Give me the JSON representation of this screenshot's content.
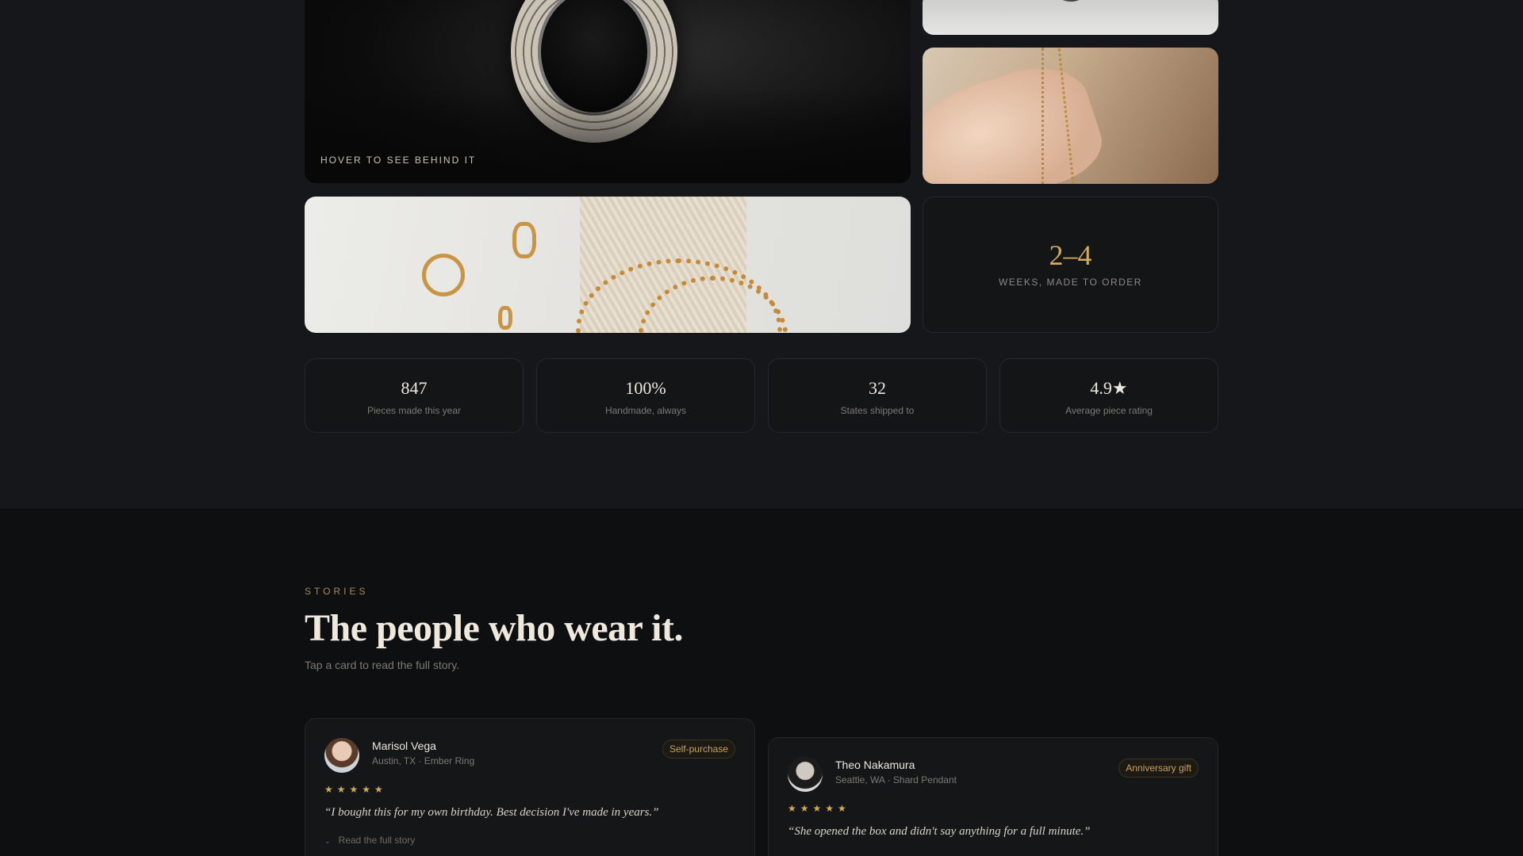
{
  "gallery": {
    "ring_photo": {
      "caption": "HOVER TO SEE BEHIND IT"
    },
    "lead_time": {
      "value": "2–4",
      "label": "WEEKS, MADE TO ORDER"
    }
  },
  "stats": [
    {
      "value": "847",
      "label": "Pieces made this year"
    },
    {
      "value": "100%",
      "label": "Handmade, always"
    },
    {
      "value": "32",
      "label": "States shipped to"
    },
    {
      "value": "4.9★",
      "label": "Average piece rating"
    }
  ],
  "stories": {
    "eyebrow": "STORIES",
    "title": "The people who wear it.",
    "subtitle": "Tap a card to read the full story.",
    "cards": [
      {
        "name": "Marisol Vega",
        "meta": "Austin, TX · Ember Ring",
        "tag": "Self-purchase",
        "rating": 5,
        "stars": "★★★★★",
        "quote": "“I bought this for my own birthday. Best decision I've made in years.”",
        "read_more": "Read the full story"
      },
      {
        "name": "Theo Nakamura",
        "meta": "Seattle, WA · Shard Pendant",
        "tag": "Anniversary gift",
        "rating": 5,
        "stars": "★★★★★",
        "quote": "“She opened the box and didn't say anything for a full minute.”"
      }
    ]
  },
  "colors": {
    "accent_gold": "#d4aa5a",
    "background": "#16171a",
    "stories_background": "#0e0f11"
  }
}
